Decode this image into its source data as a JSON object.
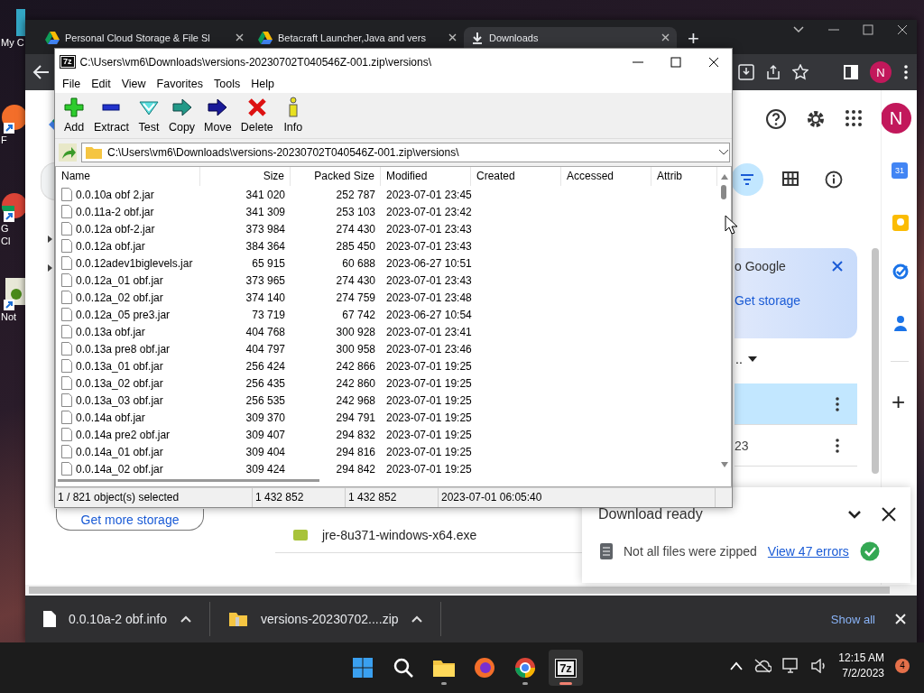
{
  "desktop_icons": [
    {
      "lines": [
        "My C"
      ],
      "kind": "pc"
    },
    {
      "lines": [
        "F"
      ],
      "kind": "firefox"
    },
    {
      "lines": [
        "G",
        "Cl"
      ],
      "kind": "chrome"
    },
    {
      "lines": [
        "Not"
      ],
      "kind": "notepad"
    }
  ],
  "browser": {
    "tabs": [
      {
        "title": "Personal Cloud Storage & File Sl",
        "kind": "drive",
        "selected": false
      },
      {
        "title": "Betacraft Launcher,Java and vers",
        "kind": "drive",
        "selected": false
      },
      {
        "title": "Downloads",
        "kind": "download",
        "selected": true
      }
    ],
    "new_tab": "+",
    "profile": "N",
    "page": {
      "avatar": "N",
      "side_apps": [
        {
          "kind": "calendar",
          "label": "31"
        },
        {
          "kind": "keep"
        },
        {
          "kind": "tasks"
        },
        {
          "kind": "contacts"
        }
      ],
      "add_app": "+",
      "promo": {
        "text": "o Google",
        "action": "Get storage"
      },
      "sort_label": "..",
      "rows": [
        {
          "selected": true
        },
        {
          "text": "23",
          "selected": false
        }
      ],
      "get_more_storage": "Get more storage",
      "file_row": "jre-8u371-windows-x64.exe",
      "download_popup": {
        "title": "Download ready",
        "message": "Not all files were zipped",
        "link": "View 47 errors"
      }
    },
    "download_bar": {
      "items": [
        {
          "name": "0.0.10a-2 obf.info",
          "kind": "file"
        },
        {
          "name": "versions-20230702....zip",
          "kind": "zip"
        }
      ],
      "show_all": "Show all"
    }
  },
  "sevenzip": {
    "app_icon": "7z",
    "title": "C:\\Users\\vm6\\Downloads\\versions-20230702T040546Z-001.zip\\versions\\",
    "menu": [
      "File",
      "Edit",
      "View",
      "Favorites",
      "Tools",
      "Help"
    ],
    "toolbar": [
      {
        "label": "Add",
        "kind": "add"
      },
      {
        "label": "Extract",
        "kind": "extract"
      },
      {
        "label": "Test",
        "kind": "test"
      },
      {
        "label": "Copy",
        "kind": "copy"
      },
      {
        "label": "Move",
        "kind": "move"
      },
      {
        "label": "Delete",
        "kind": "delete"
      },
      {
        "label": "Info",
        "kind": "info"
      }
    ],
    "address": "C:\\Users\\vm6\\Downloads\\versions-20230702T040546Z-001.zip\\versions\\",
    "columns": [
      "Name",
      "Size",
      "Packed Size",
      "Modified",
      "Created",
      "Accessed",
      "Attrib"
    ],
    "rows": [
      {
        "name": "0.0.10a obf 2.jar",
        "size": "341 020",
        "packed": "252 787",
        "modified": "2023-07-01 23:45"
      },
      {
        "name": "0.0.11a-2 obf.jar",
        "size": "341 309",
        "packed": "253 103",
        "modified": "2023-07-01 23:42"
      },
      {
        "name": "0.0.12a obf-2.jar",
        "size": "373 984",
        "packed": "274 430",
        "modified": "2023-07-01 23:43"
      },
      {
        "name": "0.0.12a obf.jar",
        "size": "384 364",
        "packed": "285 450",
        "modified": "2023-07-01 23:43"
      },
      {
        "name": "0.0.12adev1biglevels.jar",
        "size": "65 915",
        "packed": "60 688",
        "modified": "2023-06-27 10:51"
      },
      {
        "name": "0.0.12a_01 obf.jar",
        "size": "373 965",
        "packed": "274 430",
        "modified": "2023-07-01 23:43"
      },
      {
        "name": "0.0.12a_02 obf.jar",
        "size": "374 140",
        "packed": "274 759",
        "modified": "2023-07-01 23:48"
      },
      {
        "name": "0.0.12a_05 pre3.jar",
        "size": "73 719",
        "packed": "67 742",
        "modified": "2023-06-27 10:54"
      },
      {
        "name": "0.0.13a obf.jar",
        "size": "404 768",
        "packed": "300 928",
        "modified": "2023-07-01 23:41"
      },
      {
        "name": "0.0.13a pre8 obf.jar",
        "size": "404 797",
        "packed": "300 958",
        "modified": "2023-07-01 23:46"
      },
      {
        "name": "0.0.13a_01 obf.jar",
        "size": "256 424",
        "packed": "242 866",
        "modified": "2023-07-01 19:25"
      },
      {
        "name": "0.0.13a_02 obf.jar",
        "size": "256 435",
        "packed": "242 860",
        "modified": "2023-07-01 19:25"
      },
      {
        "name": "0.0.13a_03 obf.jar",
        "size": "256 535",
        "packed": "242 968",
        "modified": "2023-07-01 19:25"
      },
      {
        "name": "0.0.14a obf.jar",
        "size": "309 370",
        "packed": "294 791",
        "modified": "2023-07-01 19:25"
      },
      {
        "name": "0.0.14a pre2 obf.jar",
        "size": "309 407",
        "packed": "294 832",
        "modified": "2023-07-01 19:25"
      },
      {
        "name": "0.0.14a_01 obf.jar",
        "size": "309 404",
        "packed": "294 816",
        "modified": "2023-07-01 19:25"
      },
      {
        "name": "0.0.14a_02 obf.jar",
        "size": "309 424",
        "packed": "294 842",
        "modified": "2023-07-01 19:25"
      }
    ],
    "status": [
      "1 / 821 object(s) selected",
      "1 432 852",
      "1 432 852",
      "2023-07-01 06:05:40"
    ]
  },
  "taskbar": {
    "apps": [
      {
        "kind": "windows",
        "running": false,
        "active": false
      },
      {
        "kind": "search",
        "running": false,
        "active": false
      },
      {
        "kind": "explorer",
        "running": true,
        "active": false
      },
      {
        "kind": "firefox",
        "running": false,
        "active": false
      },
      {
        "kind": "chrome",
        "running": true,
        "active": false
      },
      {
        "kind": "sevenzip",
        "label": "7z",
        "running": true,
        "active": true
      }
    ],
    "time": "12:15 AM",
    "date": "7/2/2023",
    "notifications": "4"
  }
}
